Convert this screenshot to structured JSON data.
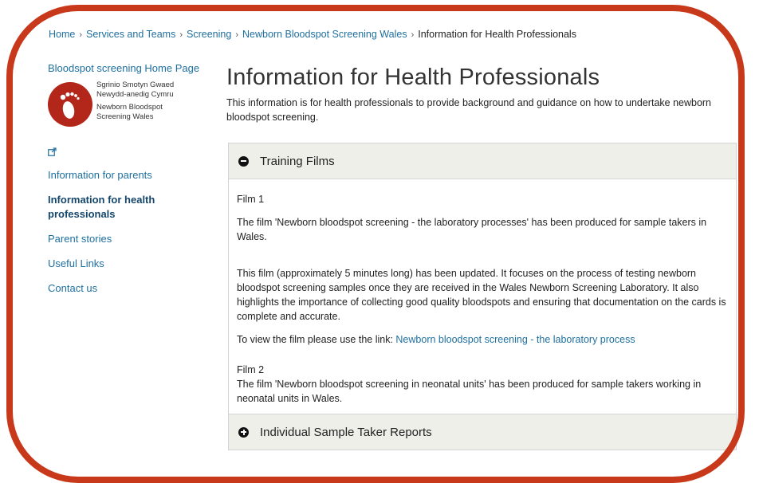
{
  "breadcrumb": {
    "home": "Home",
    "services": "Services and Teams",
    "screening": "Screening",
    "newborn": "Newborn Bloodspot Screening Wales",
    "current": "Information for Health Professionals",
    "separator": "›"
  },
  "sidebar": {
    "home_link": "Bloodspot screening Home Page",
    "logo": {
      "welsh_line1": "Sgrinio Smotyn Gwaed",
      "welsh_line2": "Newydd-anedig Cymru",
      "english_line1": "Newborn Bloodspot",
      "english_line2": "Screening Wales"
    },
    "external_icon": "external-link-icon",
    "items": [
      {
        "label": "Information for parents",
        "active": false
      },
      {
        "label": "Information for health professionals",
        "active": true
      },
      {
        "label": "Parent stories",
        "active": false
      },
      {
        "label": "Useful Links",
        "active": false
      },
      {
        "label": "Contact us",
        "active": false
      }
    ]
  },
  "main": {
    "title": "Information for Health Professionals",
    "intro": "This information is for health professionals to provide background and guidance on how to undertake newborn bloodspot screening."
  },
  "accordion": {
    "section1": {
      "label": "Training Films",
      "state_icon": "minus-circle-icon",
      "film1_heading": "Film 1",
      "film1_p1": "The film 'Newborn bloodspot screening - the laboratory processes' has been produced for sample takers in Wales.",
      "film1_p2": "This film (approximately 5 minutes long) has been updated. It focuses on the process of testing newborn bloodspot screening samples once they are received in the Wales Newborn Screening Laboratory. It also highlights the importance of collecting good quality bloodspots and ensuring that documentation on the cards is complete and accurate.",
      "link_prefix": "To view the film please use the link: ",
      "link_text": "Newborn bloodspot screening - the laboratory process",
      "film2_heading": "Film 2",
      "film2_p1": "The film 'Newborn bloodspot screening in neonatal units' has been produced for sample takers working in neonatal units in Wales."
    },
    "section2": {
      "label": "Individual Sample Taker Reports",
      "state_icon": "plus-circle-icon"
    }
  },
  "colors": {
    "link": "#1f6f9f",
    "frame": "#c8391b",
    "logo": "#b2271a",
    "accordion_header": "#efefe9"
  }
}
